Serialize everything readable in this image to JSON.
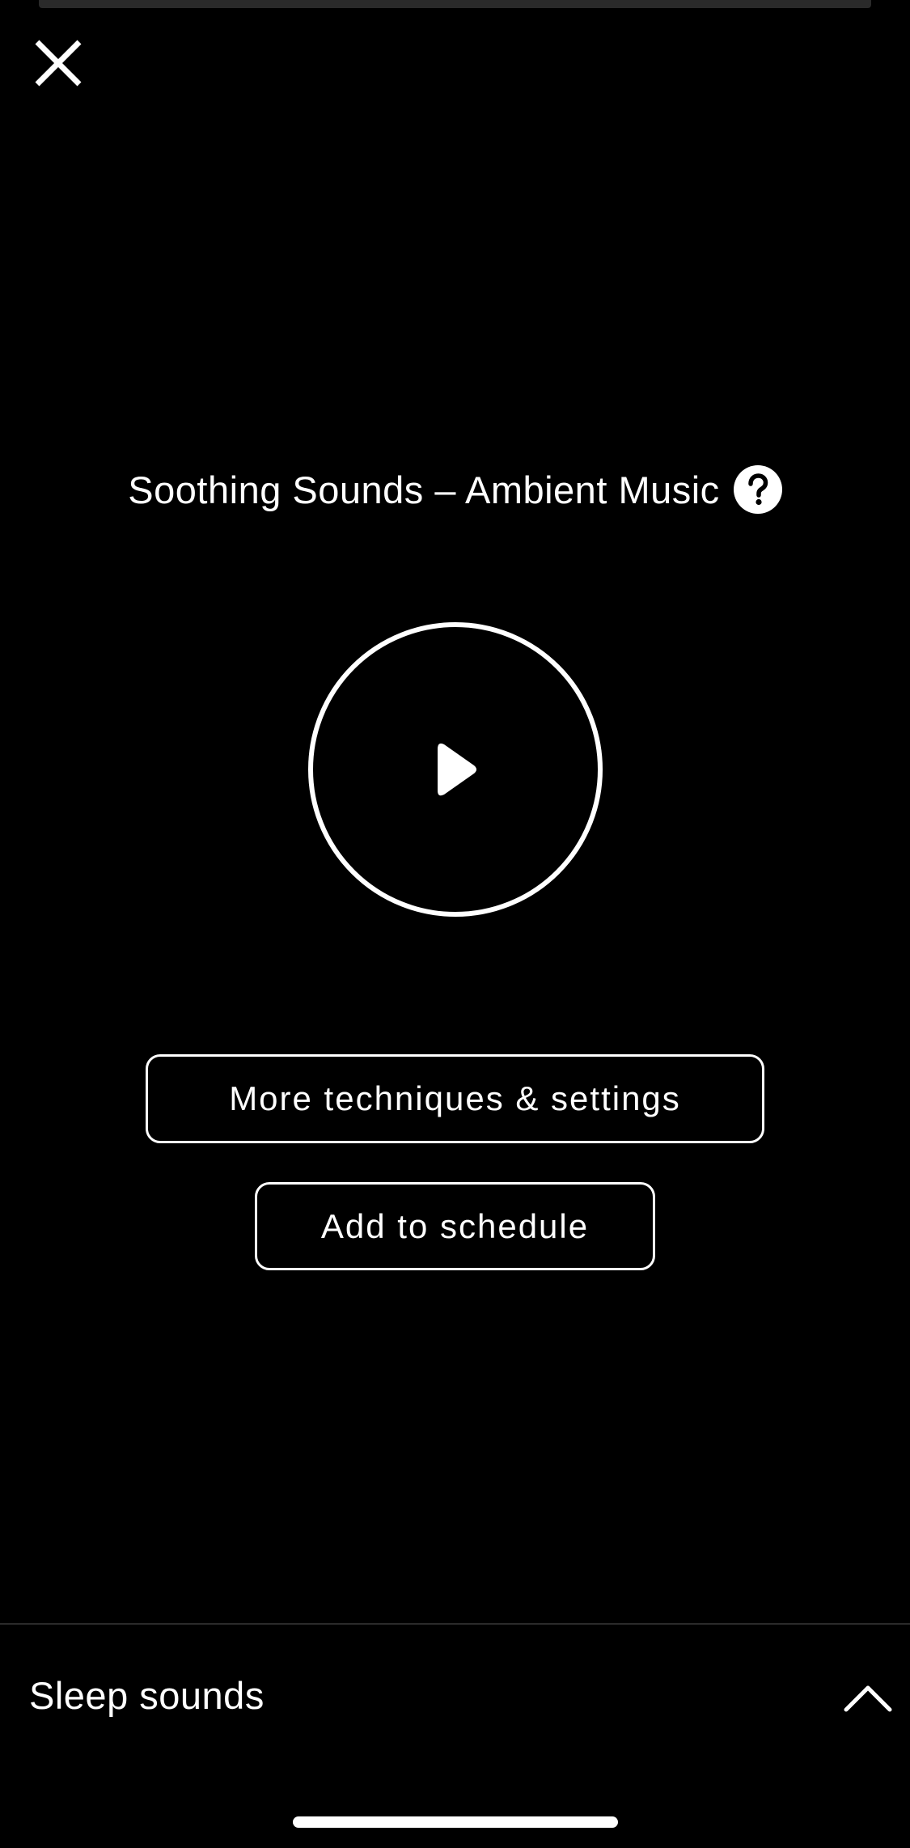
{
  "player": {
    "title": "Soothing Sounds – Ambient Music",
    "icons": {
      "close": "close-icon",
      "help": "question-mark-icon",
      "play": "play-icon",
      "expand": "chevron-up-icon"
    }
  },
  "actions": {
    "more_label": "More techniques & settings",
    "schedule_label": "Add to schedule"
  },
  "sheet": {
    "title": "Sleep sounds"
  },
  "colors": {
    "background": "#000000",
    "foreground": "#ffffff",
    "divider": "#2a2a2a"
  }
}
